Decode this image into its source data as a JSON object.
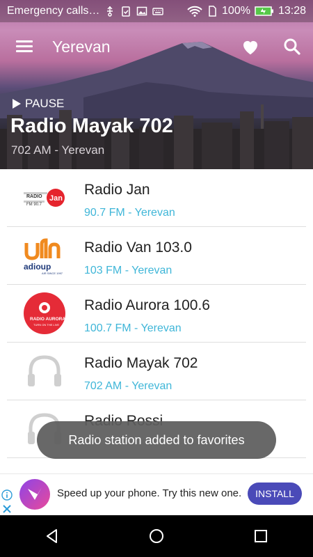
{
  "status_bar": {
    "carrier": "Emergency calls…",
    "battery": "100%",
    "time": "13:28",
    "icons": [
      "usb-icon",
      "clipboard-check-icon",
      "image-icon",
      "keyboard-icon",
      "wifi-icon",
      "sim-icon",
      "battery-icon"
    ]
  },
  "header": {
    "city": "Yerevan",
    "play_state": "PAUSE",
    "now_playing_title": "Radio Mayak 702",
    "now_playing_subtitle": "702 AM - Yerevan"
  },
  "stations": [
    {
      "name": "Radio Jan",
      "frequency": "90.7 FM - Yerevan",
      "logo": "radio-jan-logo"
    },
    {
      "name": "Radio Van 103.0",
      "frequency": "103 FM - Yerevan",
      "logo": "radio-van-logo"
    },
    {
      "name": "Radio Aurora 100.6",
      "frequency": "100.7 FM - Yerevan",
      "logo": "radio-aurora-logo"
    },
    {
      "name": "Radio Mayak 702",
      "frequency": "702 AM - Yerevan",
      "logo": "headphones-placeholder"
    },
    {
      "name": "Radio Rossi",
      "frequency": "",
      "logo": "headphones-placeholder"
    }
  ],
  "logo_text": {
    "jan_radio": "RADIO",
    "jan_freq": "FM 90.7",
    "jan_brand": "Jan",
    "van_text": "adioup",
    "van_sub": "AIR SINCE 1997",
    "aurora_name": "RADIO AURORA",
    "aurora_tag": "TURN ON THE LIVE"
  },
  "toast": {
    "message": "Radio station added to favorites"
  },
  "ad": {
    "text": "Speed up your phone. Try this new one.",
    "button": "INSTALL"
  },
  "colors": {
    "accent": "#3fb6d8",
    "install_button": "#4a4ab8",
    "aurora_red": "#e52b37",
    "van_orange": "#f08a1f"
  }
}
